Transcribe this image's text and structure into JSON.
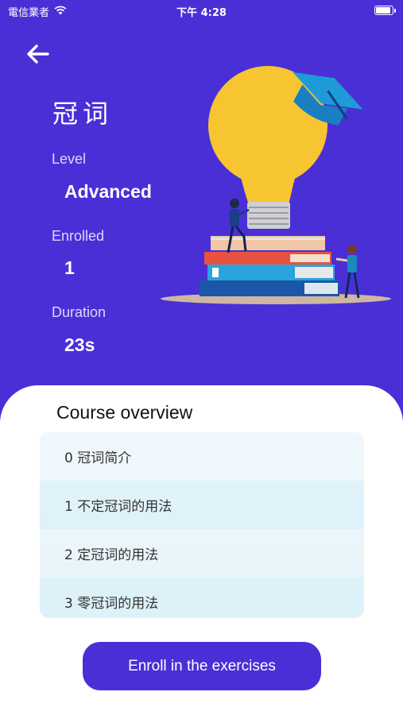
{
  "status_bar": {
    "carrier": "電信業者",
    "time": "下午 4:28"
  },
  "header": {
    "back_icon": "arrow-left-icon",
    "course_title": "冠词"
  },
  "info": {
    "level_label": "Level",
    "level_value": "Advanced",
    "enrolled_label": "Enrolled",
    "enrolled_value": "1",
    "duration_label": "Duration",
    "duration_value": "23s"
  },
  "overview": {
    "title": "Course overview",
    "items": [
      {
        "label": "0 冠词简介"
      },
      {
        "label": "1 不定冠词的用法"
      },
      {
        "label": "2 定冠词的用法"
      },
      {
        "label": "3 零冠词的用法"
      }
    ]
  },
  "actions": {
    "enroll_label": "Enroll in the exercises"
  },
  "colors": {
    "primary": "#4a2fd6",
    "sheet": "#ffffff",
    "list_bg": "#eaf6fb"
  }
}
